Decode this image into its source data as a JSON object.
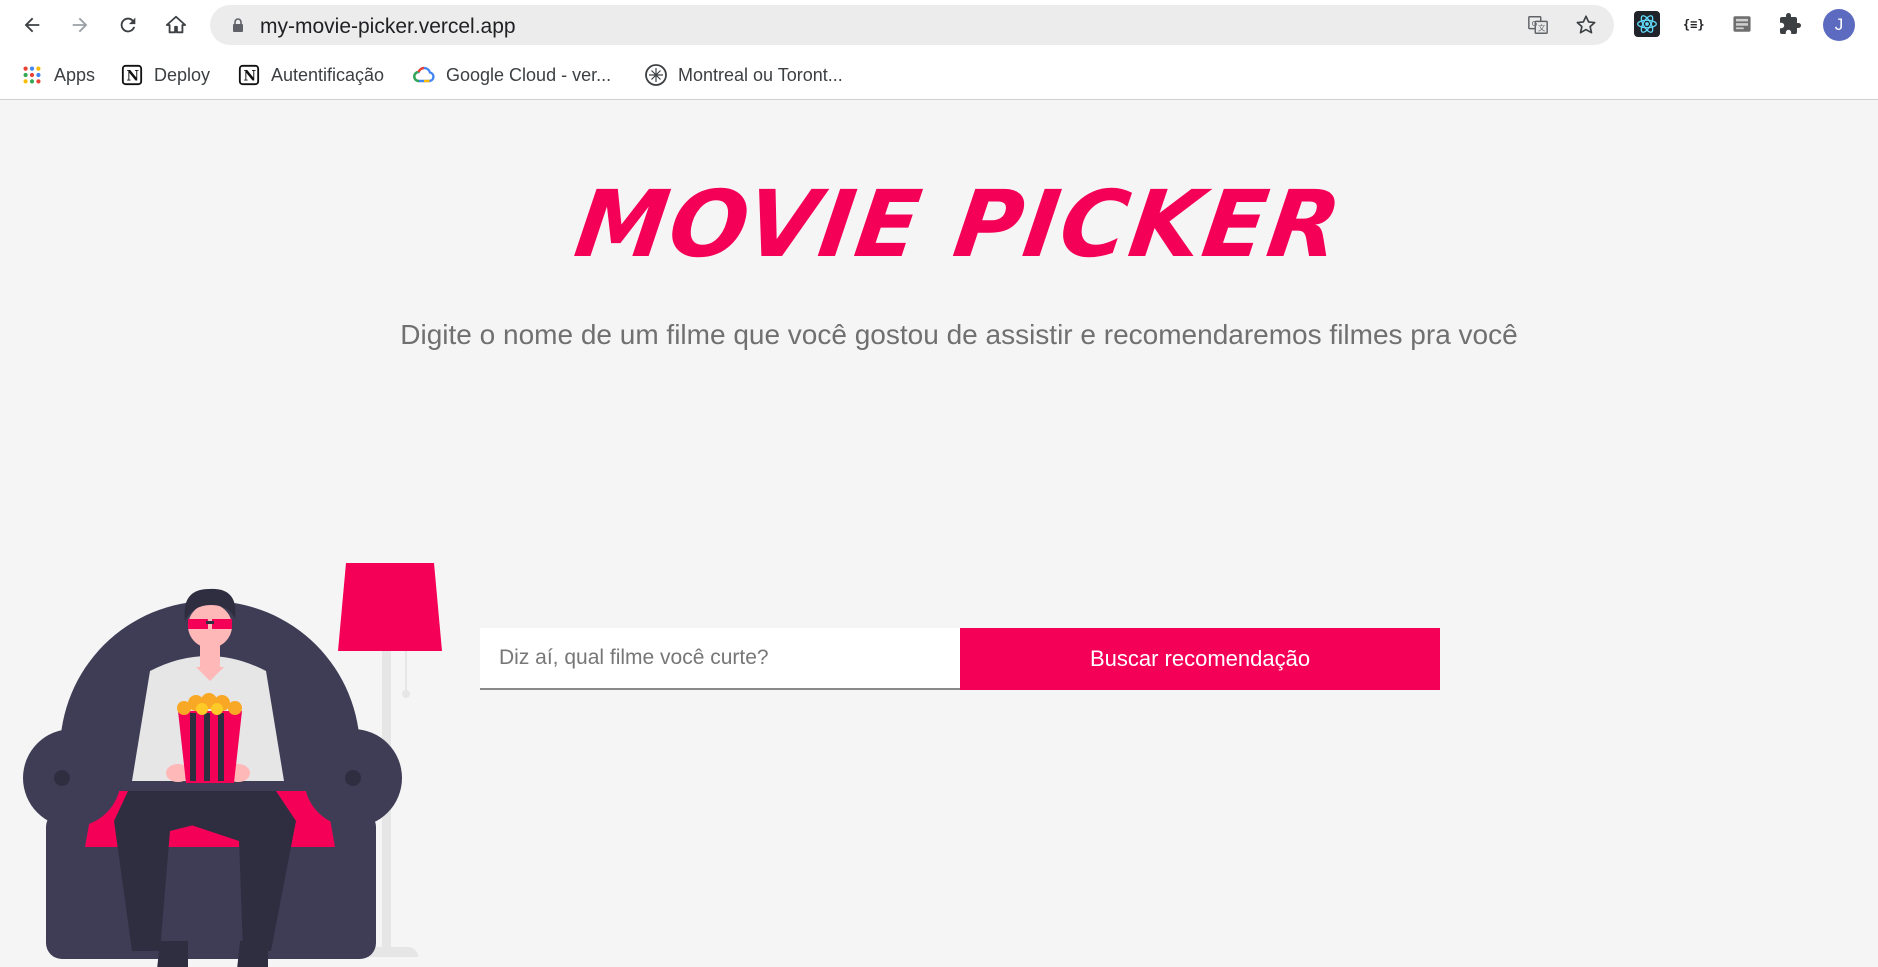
{
  "browser": {
    "url": "my-movie-picker.vercel.app",
    "avatar_letter": "J",
    "colors": {
      "avatar": "#5c6bc0"
    },
    "bookmarks": [
      {
        "label": "Apps",
        "icon": "apps-grid-icon"
      },
      {
        "label": "Deploy",
        "icon": "notion-icon"
      },
      {
        "label": "Autentificação",
        "icon": "notion-icon"
      },
      {
        "label": "Google Cloud - ver...",
        "icon": "google-cloud-icon"
      },
      {
        "label": "Montreal ou Toront...",
        "icon": "compass-icon"
      }
    ],
    "extensions": [
      "react-devtools-icon",
      "json-formatter-icon",
      "extension-box-icon",
      "puzzle-icon"
    ]
  },
  "page": {
    "title": "MOVIE PICKER",
    "subtitle": "Digite o nome de um filme que você gostou de assistir e recomendaremos filmes pra você",
    "search": {
      "placeholder": "Diz aí, qual filme você curte?",
      "value": ""
    },
    "button_label": "Buscar recomendação",
    "colors": {
      "accent": "#f50057",
      "background": "#f5f5f5",
      "subtitle": "#707070"
    }
  }
}
